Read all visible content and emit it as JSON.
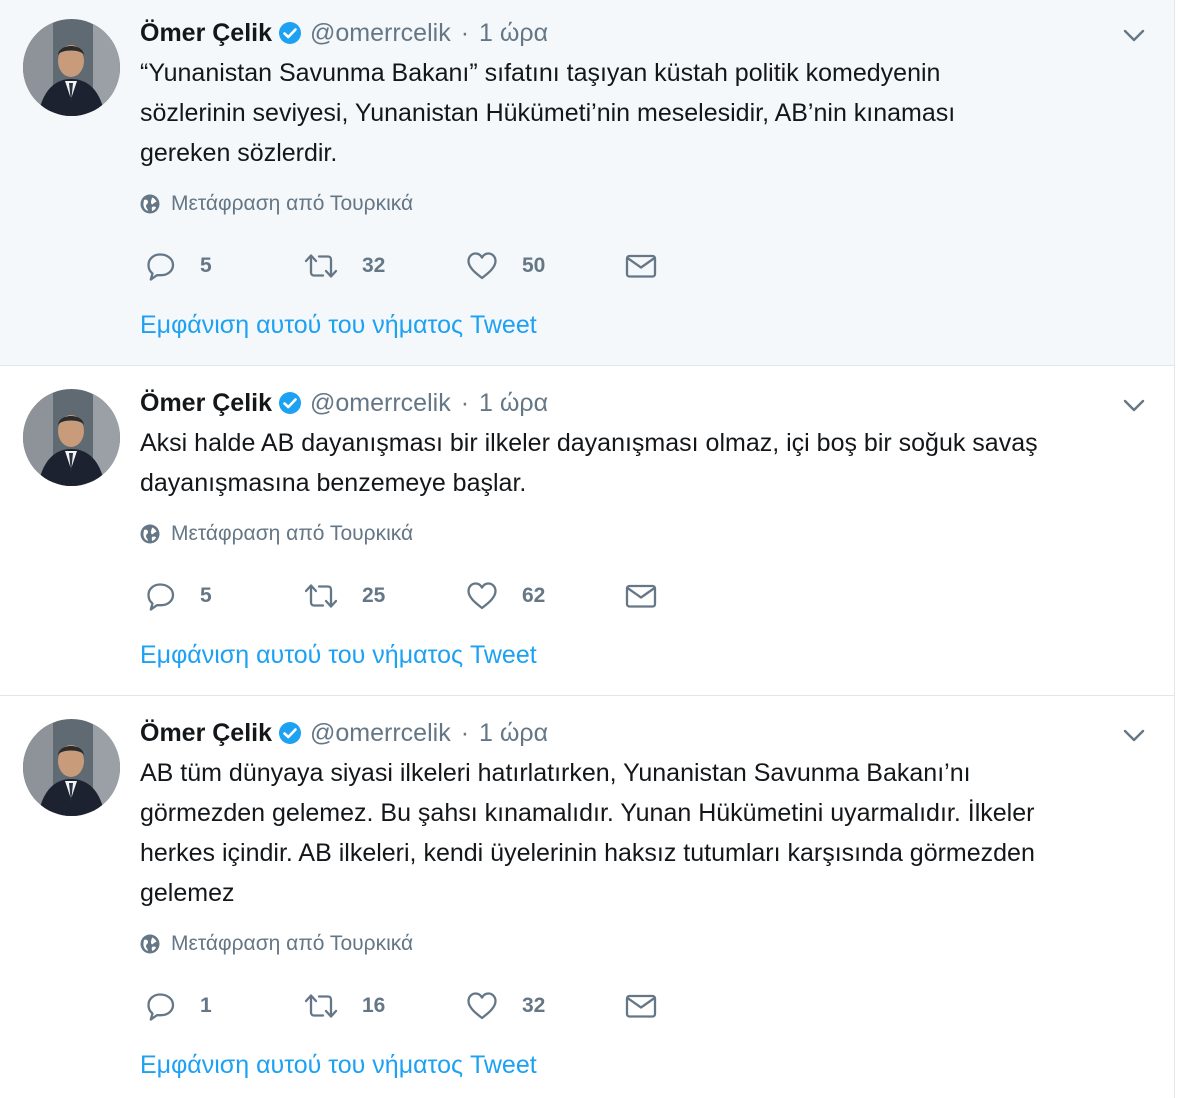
{
  "colors": {
    "link": "#1da1f2",
    "muted": "#657786",
    "verified": "#1da1f2",
    "highlight_bg": "#f5f8fa",
    "border": "#e1e8ed"
  },
  "tweets": [
    {
      "author": {
        "name": "Ömer Çelik",
        "handle": "@omerrcelik",
        "verified": true,
        "avatar_icon": "profile-photo"
      },
      "separator": "·",
      "time": "1 ώρα",
      "lines": [
        "“Yunanistan Savunma Bakanı” sıfatını taşıyan küstah politik komedyenin",
        "sözlerinin seviyesi, Yunanistan Hükümeti’nin meselesidir, AB’nin kınaması",
        "gereken sözlerdir."
      ],
      "translate_label": "Μετάφραση από Τουρκικά",
      "replies": "5",
      "retweets": "32",
      "likes": "50",
      "thread_link": "Εμφάνιση αυτού του νήματος Tweet"
    },
    {
      "author": {
        "name": "Ömer Çelik",
        "handle": "@omerrcelik",
        "verified": true,
        "avatar_icon": "profile-photo"
      },
      "separator": "·",
      "time": "1 ώρα",
      "lines": [
        "Aksi halde AB dayanışması bir ilkeler dayanışması olmaz, içi boş bir soğuk savaş",
        "dayanışmasına benzemeye başlar."
      ],
      "translate_label": "Μετάφραση από Τουρκικά",
      "replies": "5",
      "retweets": "25",
      "likes": "62",
      "thread_link": "Εμφάνιση αυτού του νήματος Tweet"
    },
    {
      "author": {
        "name": "Ömer Çelik",
        "handle": "@omerrcelik",
        "verified": true,
        "avatar_icon": "profile-photo"
      },
      "separator": "·",
      "time": "1 ώρα",
      "lines": [
        "AB tüm dünyaya siyasi ilkeleri hatırlatırken, Yunanistan Savunma Bakanı’nı",
        "görmezden gelemez. Bu şahsı kınamalıdır. Yunan Hükümetini uyarmalıdır. İlkeler",
        "herkes içindir. AB ilkeleri, kendi üyelerinin haksız tutumları karşısında görmezden",
        "gelemez"
      ],
      "translate_label": "Μετάφραση από Τουρκικά",
      "replies": "1",
      "retweets": "16",
      "likes": "32",
      "thread_link": "Εμφάνιση αυτού του νήματος Tweet"
    }
  ]
}
